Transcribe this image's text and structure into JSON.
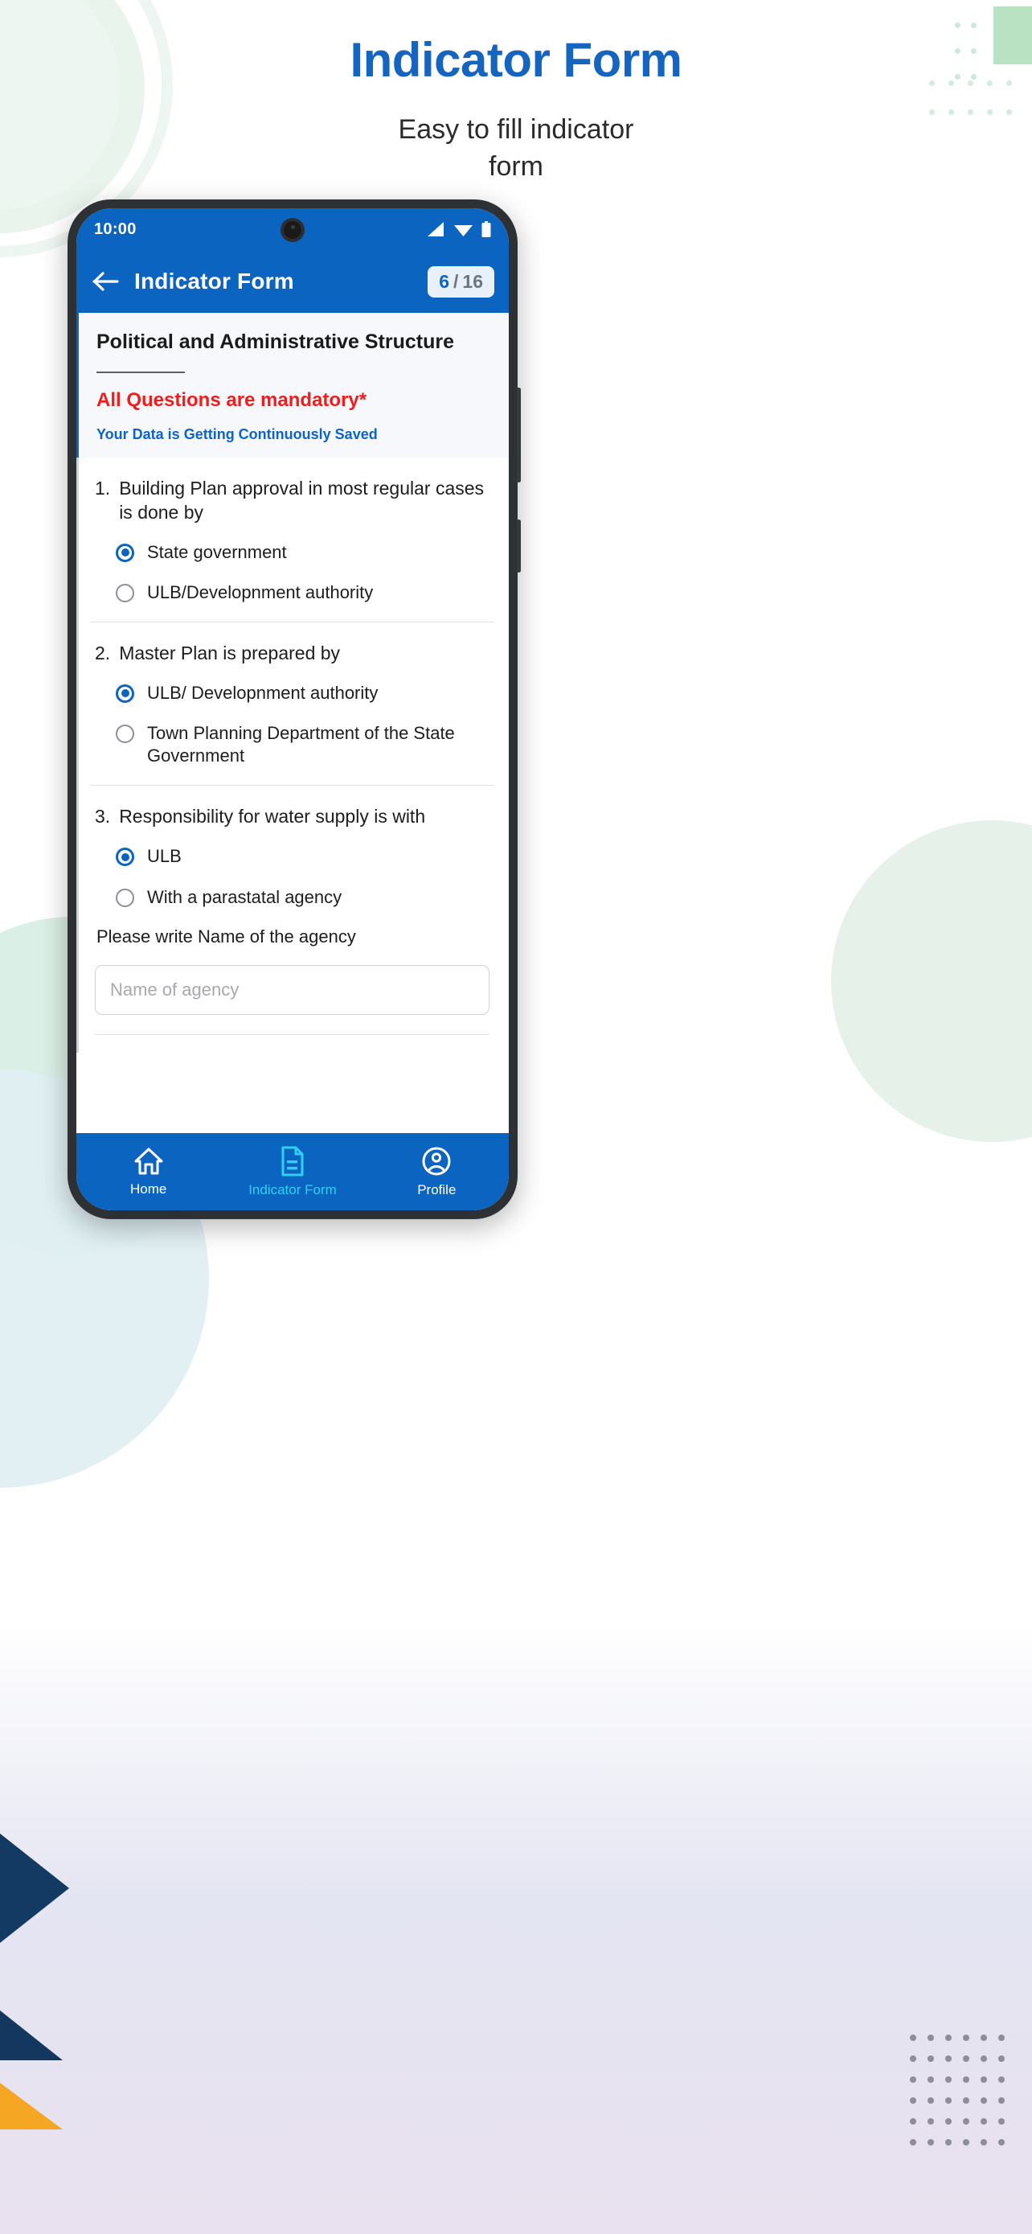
{
  "hero": {
    "title": "Indicator Form",
    "subtitle_line1": "Easy to fill indicator",
    "subtitle_line2": "form"
  },
  "colors": {
    "brand_blue": "#0b64c0",
    "title_blue": "#1565c0",
    "mandatory_red": "#f31c1c",
    "saved_blue": "#0d63c6",
    "active_nav": "#2fd0f5",
    "mint": "#b8e2c2",
    "navy": "#123a63",
    "yellow": "#f5a623"
  },
  "phone": {
    "status_bar": {
      "time": "10:00",
      "icons": [
        "signal-icon",
        "wifi-icon",
        "battery-icon"
      ]
    },
    "app_bar": {
      "back_icon": "back-arrow-icon",
      "title": "Indicator Form",
      "counter": {
        "current": "6",
        "separator": "/",
        "total": "16"
      }
    },
    "section": {
      "title": "Political and Administrative Structure",
      "mandatory_note": "All Questions are mandatory*",
      "saved_note": "Your Data is Getting Continuously Saved"
    },
    "questions": [
      {
        "number": "1.",
        "text": "Building Plan approval in most regular cases is done by",
        "options": [
          {
            "label": "State government",
            "selected": true
          },
          {
            "label": "ULB/Developnment authority",
            "selected": false
          }
        ]
      },
      {
        "number": "2.",
        "text": "Master Plan is prepared by",
        "options": [
          {
            "label": "ULB/ Developnment authority",
            "selected": true
          },
          {
            "label": "Town Planning Department of the State Government",
            "selected": false
          }
        ]
      },
      {
        "number": "3.",
        "text": "Responsibility for water supply is with",
        "options": [
          {
            "label": "ULB",
            "selected": true
          },
          {
            "label": "With a parastatal agency",
            "selected": false
          }
        ],
        "sub_label": "Please write Name of the agency",
        "input": {
          "value": "",
          "placeholder": "Name of agency"
        }
      }
    ],
    "bottom_nav": [
      {
        "label": "Home",
        "icon": "home-icon",
        "active": false
      },
      {
        "label": "Indicator Form",
        "icon": "document-icon",
        "active": true
      },
      {
        "label": "Profile",
        "icon": "profile-icon",
        "active": false
      }
    ]
  }
}
